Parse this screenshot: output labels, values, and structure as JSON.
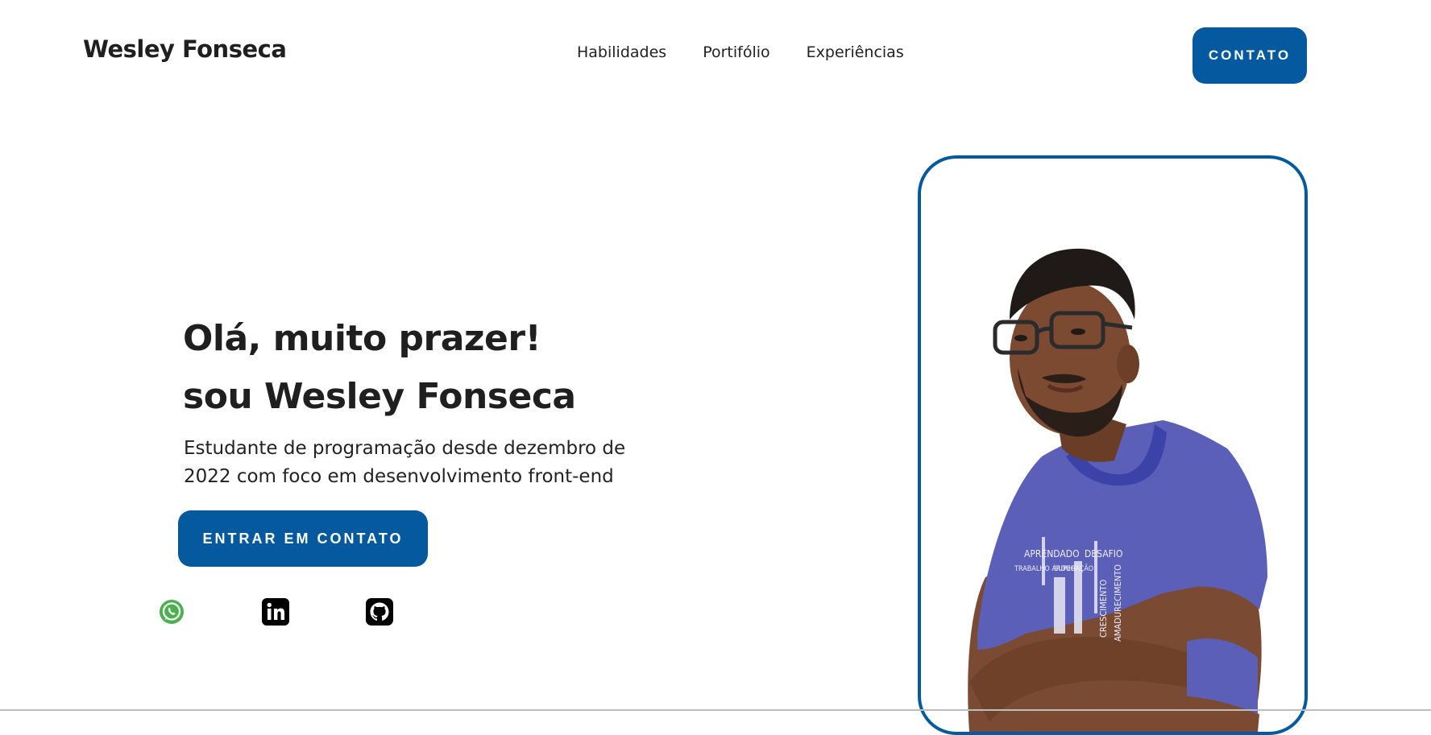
{
  "header": {
    "brand": "Wesley Fonseca",
    "nav": [
      "Habilidades",
      "Portifólio",
      "Experiências"
    ],
    "contact_label": "CONTATO"
  },
  "hero": {
    "greeting": "Olá, muito prazer!",
    "intro": "sou Wesley Fonseca",
    "description": "Estudante de programação desde dezembro de 2022 com foco em desenvolvimento front-end",
    "cta_label": "ENTRAR EM CONTATO"
  },
  "social": {
    "icons": [
      "whatsapp-icon",
      "linkedin-icon",
      "github-icon"
    ]
  },
  "portrait": {
    "shirt_text": [
      "APRENDADO",
      "DESAFIO",
      "TRABALHO ÁRDUO",
      "SUPERAÇÃO",
      "CRESCIMENTO",
      "AMADURECIMENTO"
    ]
  },
  "colors": {
    "accent": "#04599f",
    "text": "#1f1f1f",
    "background": "#ffffff"
  }
}
